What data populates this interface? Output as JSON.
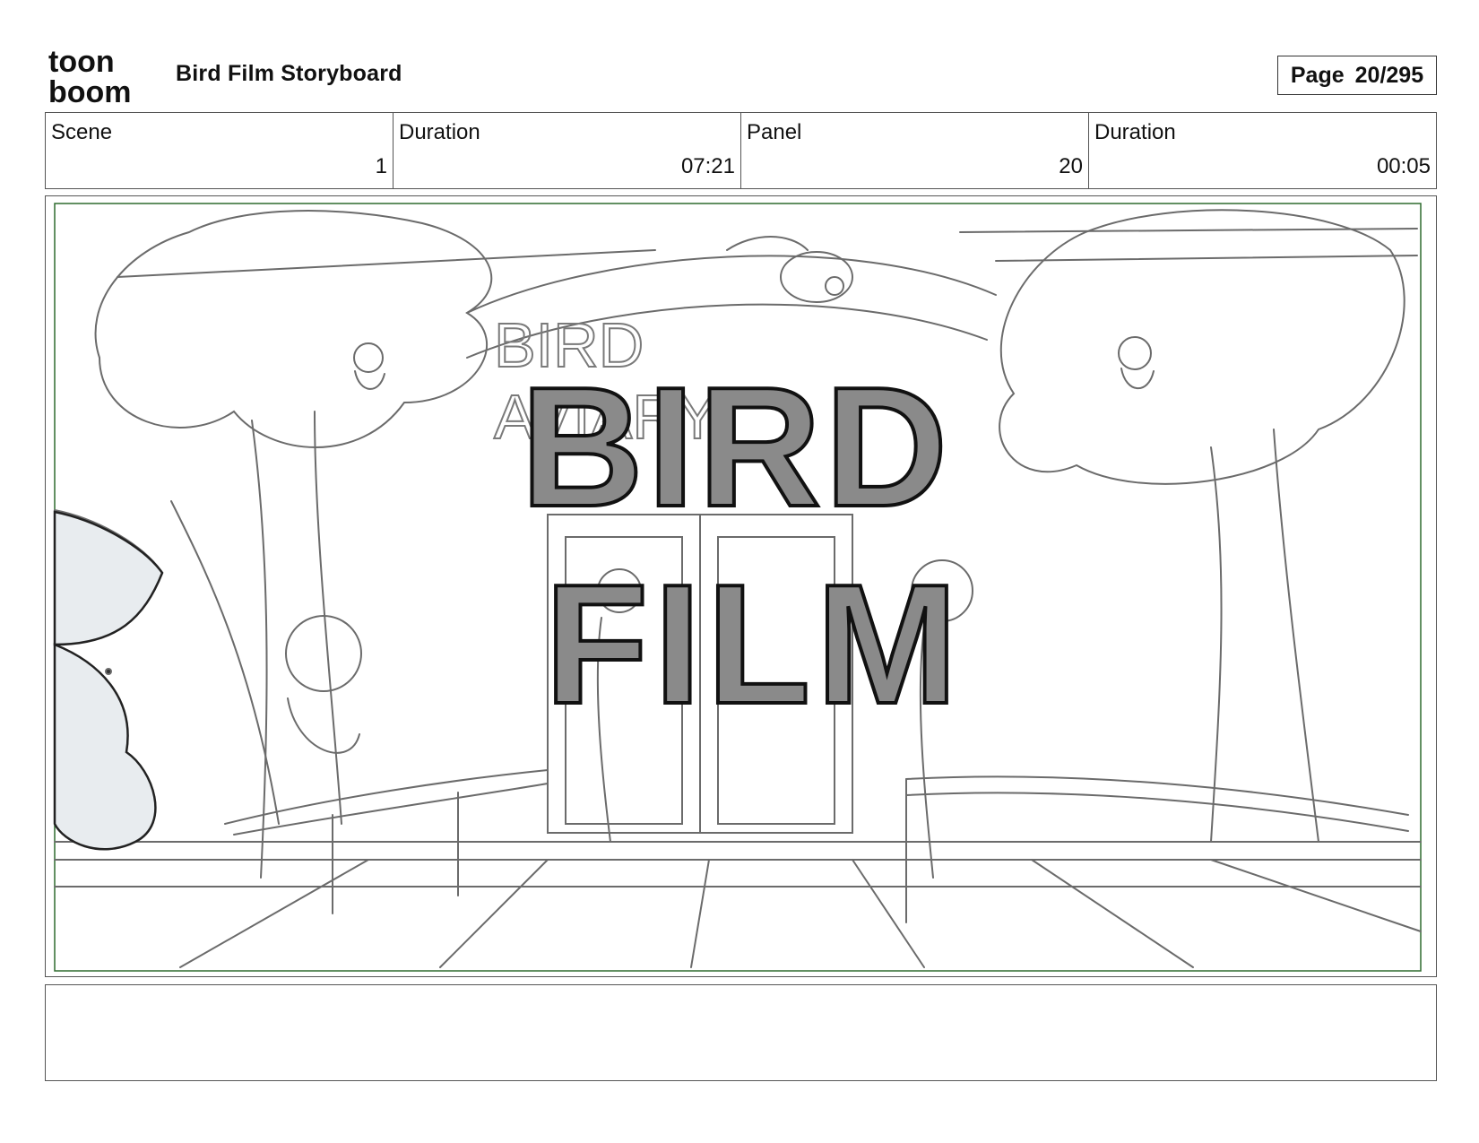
{
  "header": {
    "logo_line1": "toon",
    "logo_line2": "boom",
    "title": "Bird Film Storyboard",
    "page_label": "Page",
    "page_value": "20/295"
  },
  "info": {
    "scene_label": "Scene",
    "scene_value": "1",
    "scene_duration_label": "Duration",
    "scene_duration_value": "07:21",
    "panel_label": "Panel",
    "panel_value": "20",
    "panel_duration_label": "Duration",
    "panel_duration_value": "00:05"
  },
  "artwork": {
    "title_line1": "BIRD",
    "title_line2": "FILM",
    "sign_line1": "BIRD",
    "sign_line2": "AVIARY",
    "fill_color": "#8a8a8a",
    "sketch_color": "#6b6b6b",
    "frame_color": "#2f6b2f"
  },
  "caption": {
    "text": ""
  }
}
